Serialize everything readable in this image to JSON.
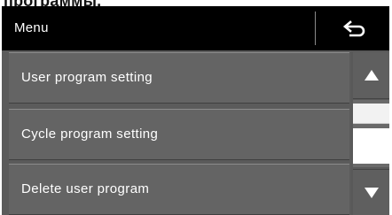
{
  "caption": {
    "text": "программы."
  },
  "header": {
    "title": "Menu",
    "back_icon": "back-arrow-icon",
    "background": "#000000",
    "text_color": "#ffffff"
  },
  "menu": {
    "items": [
      {
        "label": "User program setting"
      },
      {
        "label": "Cycle program setting"
      },
      {
        "label": "Delete user program"
      }
    ],
    "item_background": "#646464",
    "area_background": "#5b5b5b"
  },
  "scrollbar": {
    "up_icon": "triangle-up-icon",
    "down_icon": "triangle-down-icon",
    "thumb_color": "#f2f2f2"
  }
}
